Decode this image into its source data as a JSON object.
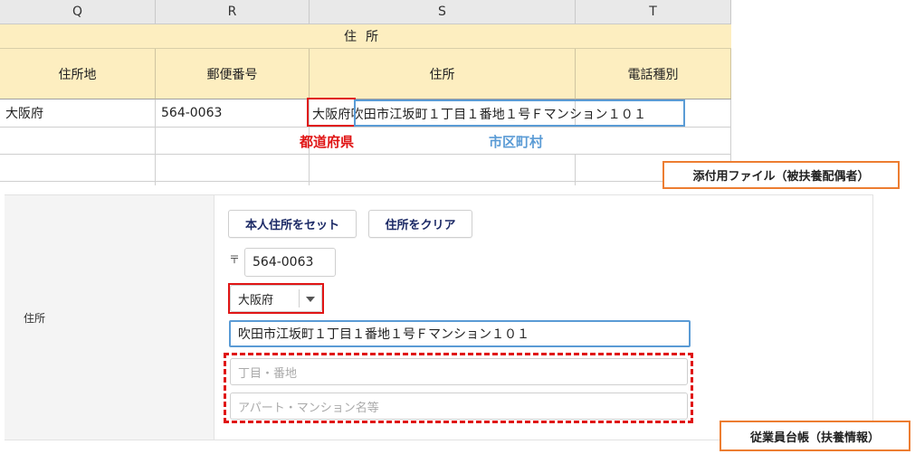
{
  "sheet": {
    "col_headers": [
      "Q",
      "R",
      "S",
      "T"
    ],
    "merged_header": "住所",
    "subheaders": [
      "住所地",
      "郵便番号",
      "住所",
      "電話種別"
    ],
    "row1": {
      "prefecture_cell": "大阪府",
      "postal_cell": "564-0063",
      "address_pref": "大阪府",
      "address_rest": "吹田市江坂町１丁目１番地１号Ｆマンション１０１"
    },
    "label_prefecture": "都道府県",
    "label_city": "市区町村"
  },
  "callouts": {
    "attachment_file": "添付用ファイル（被扶養配偶者）",
    "employee_ledger": "従業員台帳（扶養情報）"
  },
  "form": {
    "field_label": "住所",
    "set_own_address_button": "本人住所をセット",
    "clear_address_button": "住所をクリア",
    "postal_mark": "〒",
    "postal_code": "564-0063",
    "prefecture_selected": "大阪府",
    "city_address": "吹田市江坂町１丁目１番地１号Ｆマンション１０１",
    "chome_placeholder": "丁目・番地",
    "building_placeholder": "アパート・マンション名等"
  },
  "colors": {
    "header_fill": "#fdeec0",
    "highlight_red": "#e01515",
    "highlight_blue": "#5a9bd5",
    "callout_border": "#ed7d31",
    "button_text": "#1c2a66"
  }
}
